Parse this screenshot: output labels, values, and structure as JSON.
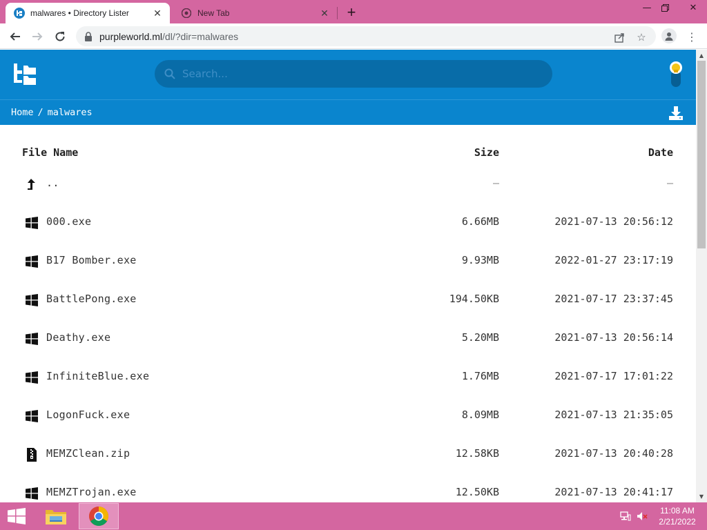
{
  "browser": {
    "tabs": [
      {
        "title": "malwares • Directory Lister",
        "active": true
      },
      {
        "title": "New Tab",
        "active": false
      }
    ],
    "url": {
      "host": "purpleworld.ml",
      "path": "/dl/?dir=malwares"
    }
  },
  "page": {
    "search_placeholder": "Search...",
    "breadcrumb": {
      "home": "Home",
      "separator": "/",
      "current": "malwares"
    },
    "columns": {
      "name": "File Name",
      "size": "Size",
      "date": "Date"
    },
    "files": [
      {
        "icon": "level-up-icon",
        "name": "..",
        "size": "—",
        "date": "—"
      },
      {
        "icon": "windows-icon",
        "name": "000.exe",
        "size": "6.66MB",
        "date": "2021-07-13 20:56:12"
      },
      {
        "icon": "windows-icon",
        "name": "B17 Bomber.exe",
        "size": "9.93MB",
        "date": "2022-01-27 23:17:19"
      },
      {
        "icon": "windows-icon",
        "name": "BattlePong.exe",
        "size": "194.50KB",
        "date": "2021-07-17 23:37:45"
      },
      {
        "icon": "windows-icon",
        "name": "Deathy.exe",
        "size": "5.20MB",
        "date": "2021-07-13 20:56:14"
      },
      {
        "icon": "windows-icon",
        "name": "InfiniteBlue.exe",
        "size": "1.76MB",
        "date": "2021-07-17 17:01:22"
      },
      {
        "icon": "windows-icon",
        "name": "LogonFuck.exe",
        "size": "8.09MB",
        "date": "2021-07-13 21:35:05"
      },
      {
        "icon": "zip-file-icon",
        "name": "MEMZClean.zip",
        "size": "12.58KB",
        "date": "2021-07-13 20:40:28"
      },
      {
        "icon": "windows-icon",
        "name": "MEMZTrojan.exe",
        "size": "12.50KB",
        "date": "2021-07-13 20:41:17"
      }
    ]
  },
  "taskbar": {
    "time": "11:08 AM",
    "date": "2/21/2022"
  },
  "colors": {
    "header_blue": "#0a85ce",
    "search_bg": "#086ca8",
    "chrome_frame": "#d466a0"
  }
}
